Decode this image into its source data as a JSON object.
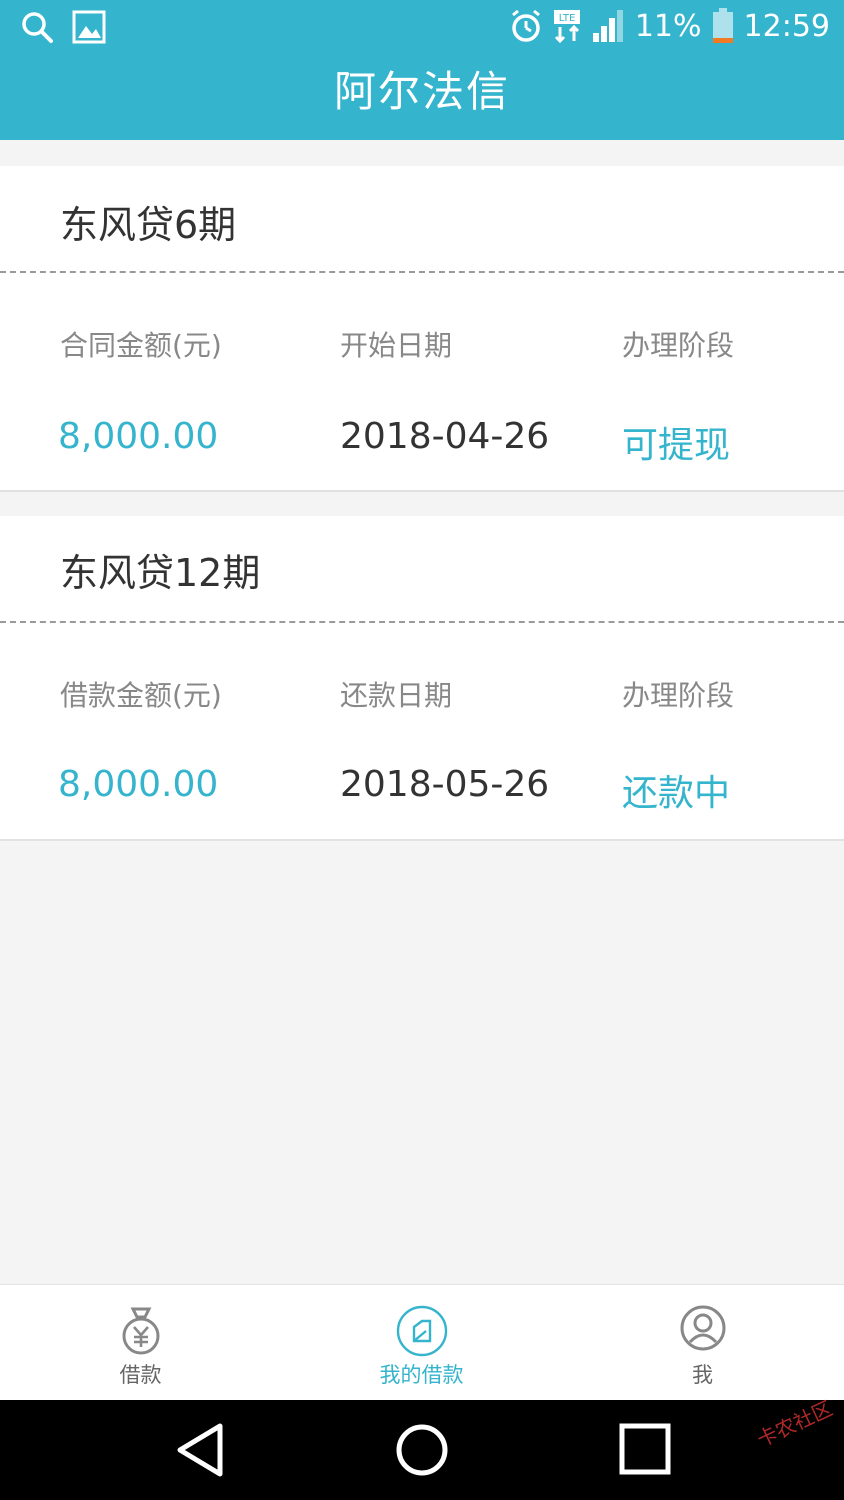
{
  "statusbar": {
    "battery": "11%",
    "time": "12:59",
    "icons": [
      "search-icon",
      "gallery-icon",
      "alarm-icon",
      "lte-icon",
      "signal-icon",
      "battery-icon"
    ]
  },
  "header": {
    "title": "阿尔法信"
  },
  "loans": [
    {
      "name": "东风贷6期",
      "amount_label": "合同金额(元)",
      "date_label": "开始日期",
      "stage_label": "办理阶段",
      "amount": "8,000.00",
      "date": "2018-04-26",
      "stage": "可提现"
    },
    {
      "name": "东风贷12期",
      "amount_label": "借款金额(元)",
      "date_label": "还款日期",
      "stage_label": "办理阶段",
      "amount": "8,000.00",
      "date": "2018-05-26",
      "stage": "还款中"
    }
  ],
  "tabbar": {
    "tabs": [
      {
        "label": "借款",
        "icon": "money-bag-icon"
      },
      {
        "label": "我的借款",
        "icon": "document-icon",
        "active": true
      },
      {
        "label": "我",
        "icon": "user-icon"
      }
    ]
  },
  "colors": {
    "accent": "#35b4cd",
    "header_bg": "#35b4cd",
    "page_bg": "#f4f4f4"
  },
  "watermark": "卡农社区"
}
